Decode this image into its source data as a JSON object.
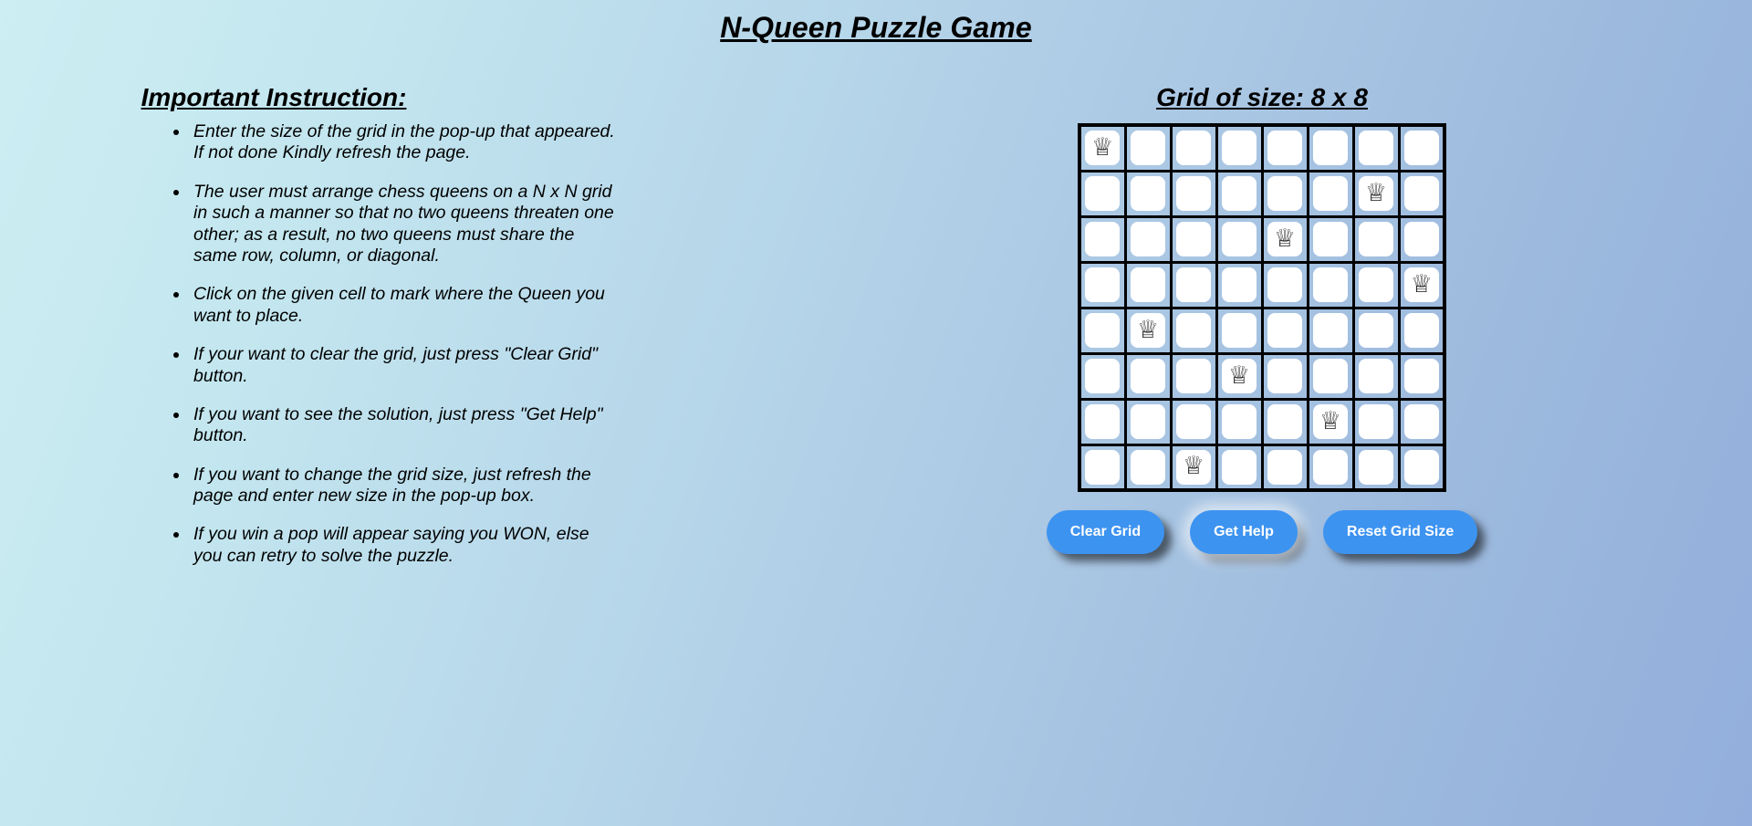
{
  "page": {
    "title": "N-Queen Puzzle Game"
  },
  "instructions": {
    "heading": "Important Instruction:",
    "items": [
      "Enter the size of the grid in the pop-up that appeared. If not done Kindly refresh the page.",
      "The user must arrange chess queens on a N x N grid in such a manner so that no two queens threaten one other; as a result, no two queens must share the same row, column, or diagonal.",
      "Click on the given cell to mark where the Queen you want to place.",
      "If your want to clear the grid, just press \"Clear Grid\" button.",
      "If you want to see the solution, just press \"Get Help\" button.",
      "If you want to change the grid size, just refresh the page and enter new size in the pop-up box.",
      "If you win a pop will appear saying you WON, else you can retry to solve the puzzle."
    ]
  },
  "board": {
    "heading": "Grid of size: 8 x 8",
    "size": 8,
    "queen_icon": "queen-icon",
    "queen_glyph": "♕",
    "queens": [
      {
        "row": 0,
        "col": 0
      },
      {
        "row": 1,
        "col": 6
      },
      {
        "row": 2,
        "col": 4
      },
      {
        "row": 3,
        "col": 7
      },
      {
        "row": 4,
        "col": 1
      },
      {
        "row": 5,
        "col": 3
      },
      {
        "row": 6,
        "col": 5
      },
      {
        "row": 7,
        "col": 2
      }
    ],
    "cell_color": "#ffffff",
    "border_color": "#000000"
  },
  "buttons": [
    {
      "id": "clear-grid",
      "label": "Clear Grid",
      "color": "#3d93f0"
    },
    {
      "id": "get-help",
      "label": "Get Help",
      "color": "#3d93f0"
    },
    {
      "id": "reset-grid-size",
      "label": "Reset Grid Size",
      "color": "#3d93f0"
    }
  ],
  "theme": {
    "bg_start": "#cdeef2",
    "bg_end": "#93aedc",
    "accent": "#3d93f0",
    "text": "#000000"
  }
}
